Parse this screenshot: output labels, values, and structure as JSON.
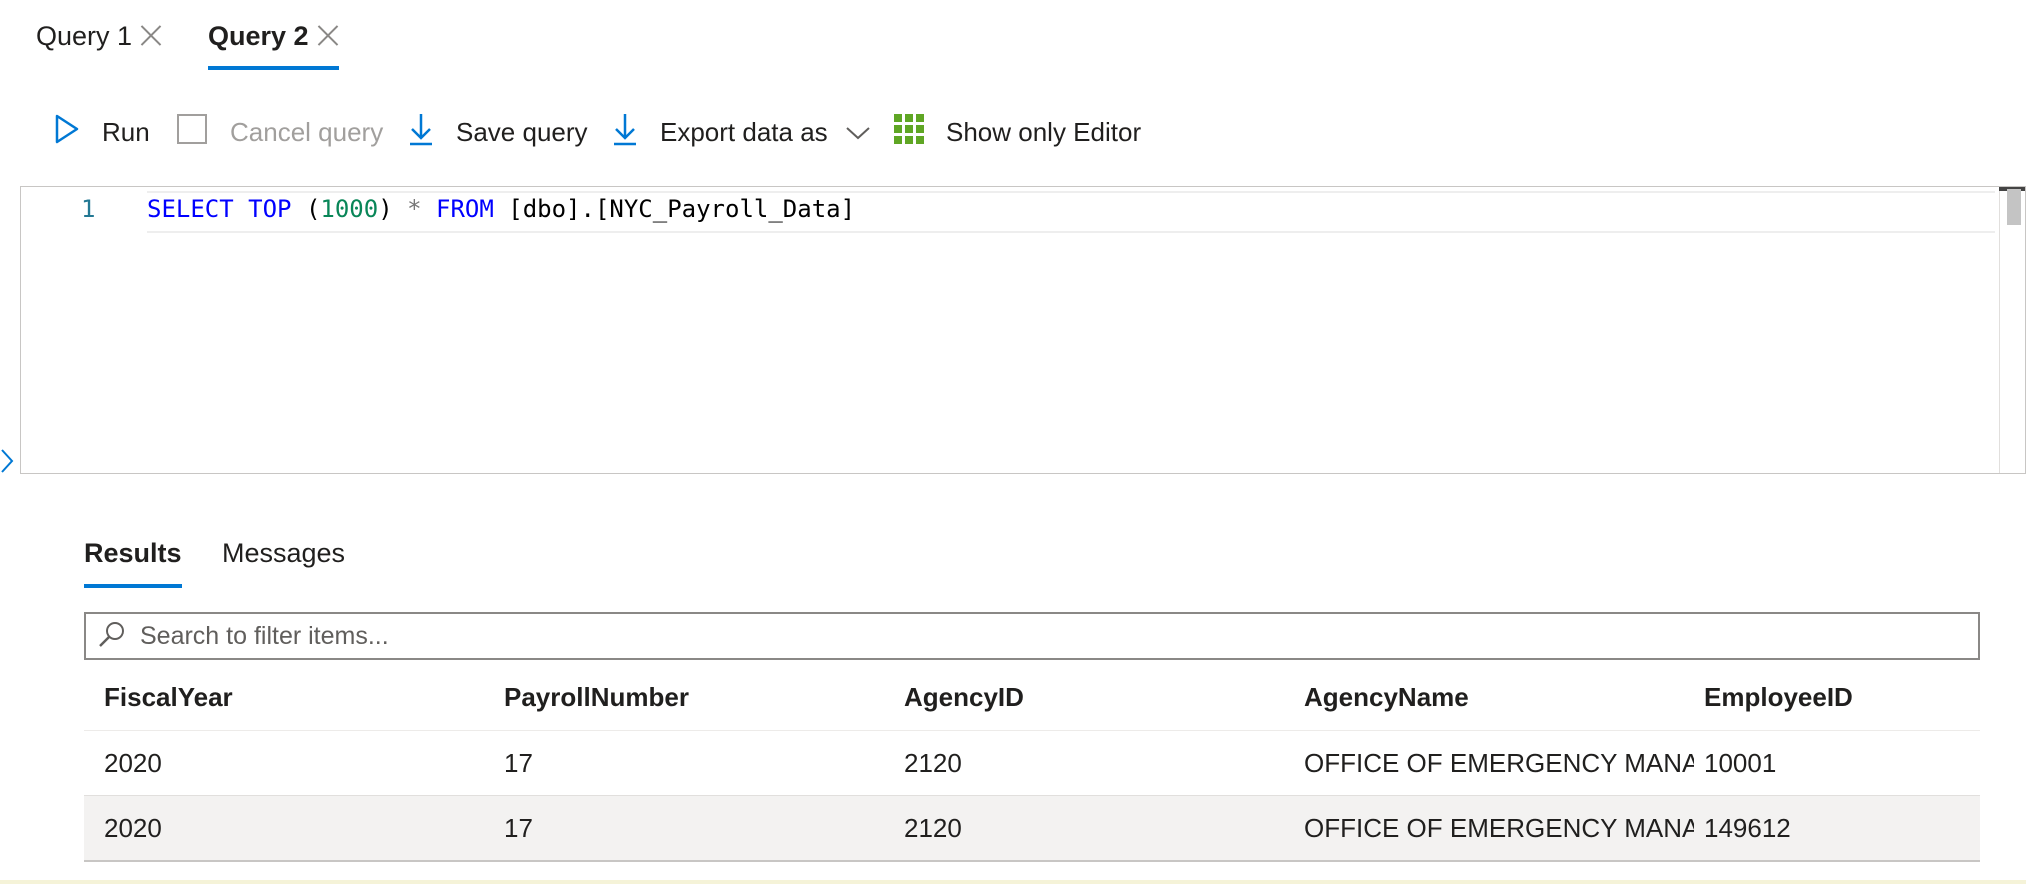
{
  "tabs": [
    {
      "label": "Query 1",
      "active": false
    },
    {
      "label": "Query 2",
      "active": true
    }
  ],
  "toolbar": {
    "run_label": "Run",
    "cancel_label": "Cancel query",
    "save_label": "Save query",
    "export_label": "Export data as",
    "show_editor_label": "Show only Editor"
  },
  "editor": {
    "line_number": "1",
    "code": {
      "kw1": "SELECT TOP",
      "paren_open": " (",
      "num": "1000",
      "paren_close": ") ",
      "star": "*",
      "space": " ",
      "kw2": "FROM",
      "rest": " [dbo].[NYC_Payroll_Data]"
    }
  },
  "results": {
    "tabs": [
      "Results",
      "Messages"
    ],
    "search_placeholder": "Search to filter items...",
    "columns": [
      "FiscalYear",
      "PayrollNumber",
      "AgencyID",
      "AgencyName",
      "EmployeeID"
    ],
    "rows": [
      [
        "2020",
        "17",
        "2120",
        "OFFICE OF EMERGENCY MANA...",
        "10001"
      ],
      [
        "2020",
        "17",
        "2120",
        "OFFICE OF EMERGENCY MANA...",
        "149612"
      ]
    ]
  },
  "colors": {
    "accent": "#0078d4",
    "keyword": "#0000ff",
    "number": "#098658",
    "grid_icon": "#5fa624"
  }
}
